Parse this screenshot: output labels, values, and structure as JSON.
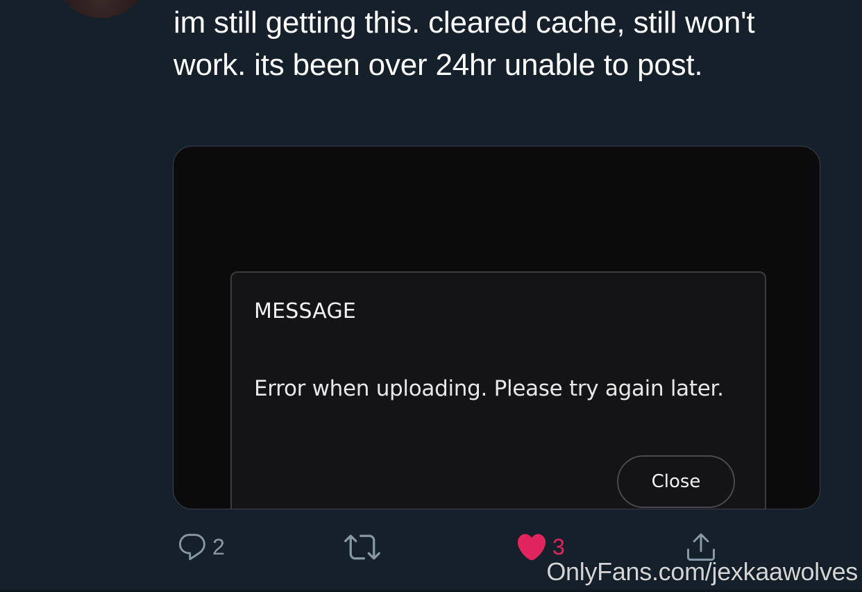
{
  "tweet": {
    "text": "im still getting this. cleared cache, still won't work. its been over 24hr unable to post."
  },
  "media": {
    "dialog": {
      "title": "MESSAGE",
      "body": "Error when uploading. Please try again later.",
      "close_label": "Close"
    }
  },
  "actions": {
    "reply": {
      "icon": "reply-icon",
      "count": "2"
    },
    "retweet": {
      "icon": "retweet-icon",
      "count": ""
    },
    "like": {
      "icon": "heart-icon",
      "count": "3",
      "liked": true,
      "color": "#e0245e"
    },
    "share": {
      "icon": "share-icon"
    }
  },
  "watermark": "OnlyFans.com/jexkaawolves",
  "colors": {
    "background": "#15202b",
    "icon_gray": "#8899a6",
    "like_red": "#e0245e"
  }
}
